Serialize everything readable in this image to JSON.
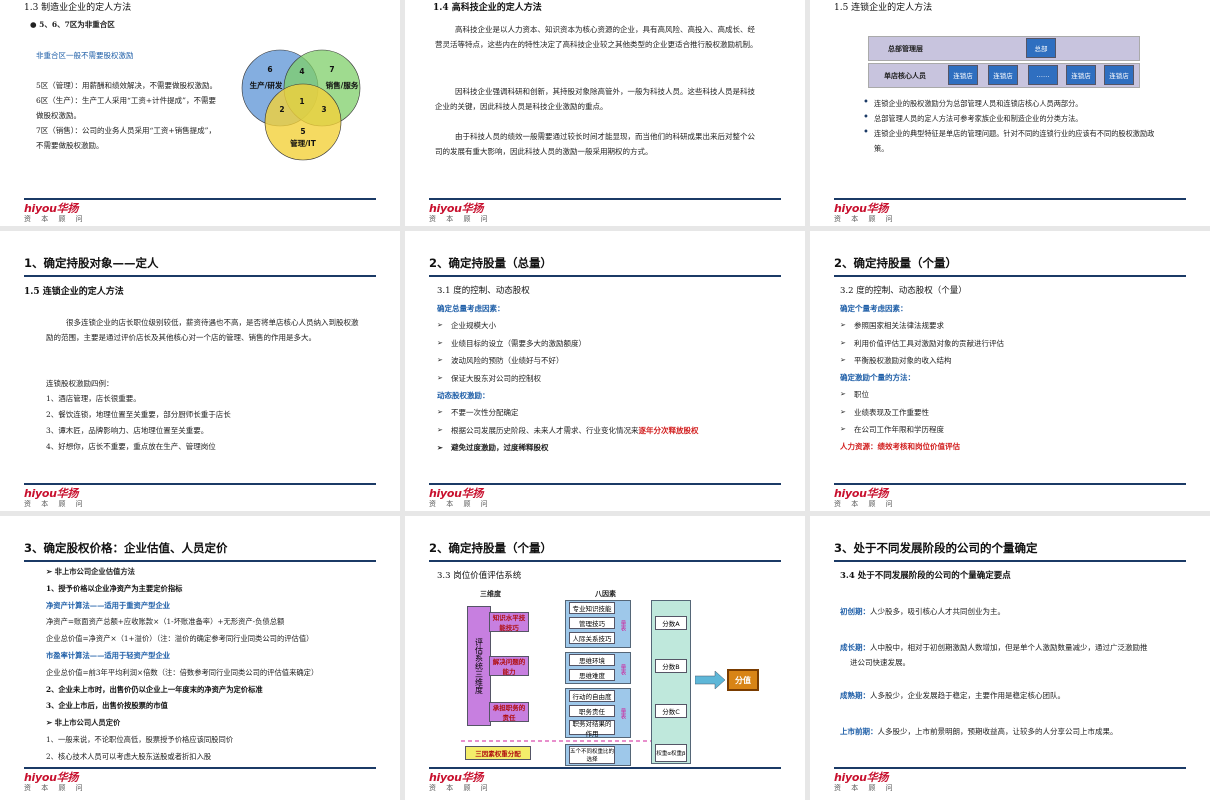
{
  "s1": {
    "section": "1.3 制造业企业的定人方法",
    "bullet": "5、6、7区为非重合区",
    "note": "非重合区一般不需要股权激励",
    "lines": [
      "5区（管理）：用薪酬和绩效解决，不需要做股权激励。",
      "6区（生产）：生产工人采用“工资+计件提成”，不需要做股权激励。",
      "7区（销售）：公司的业务人员采用“工资+销售提成”，不需要做股权激励。"
    ],
    "venn": {
      "c6": "6",
      "c7": "7",
      "c5": "5",
      "c4": "4",
      "c2": "2",
      "c3": "3",
      "c1": "1",
      "l6": "生产/研发",
      "l7": "销售/服务",
      "l5": "管理/IT"
    }
  },
  "s2": {
    "section": "1.4 高科技企业的定人方法",
    "paras": [
      "高科技企业是以人力资本、知识资本为核心资源的企业，具有高风险、高投入、高成长、经营灵活等特点，这些内在的特性决定了高科技企业较之其他类型的企业更适合推行股权激励机制。",
      "因科技企业强调科研和创新，其持股对象除高管外，一般为科技人员。这些科技人员是科技企业的关键，因此科技人员是科技企业激励的重点。",
      "由于科技人员的绩效一般需要通过较长时间才能显现，而当他们的科研成果出来后对整个公司的发展有重大影响，因此科技人员的激励一般采用期权的方式。"
    ]
  },
  "s3": {
    "section": "1.5 连锁企业的定人方法",
    "org": {
      "row1": "总部管理层",
      "row2": "单店核心人员",
      "hq": "总部",
      "store": "连锁店",
      "dots": "……"
    },
    "bullets": [
      "连锁企业的股权激励分为总部管理人员和连锁店核心人员两部分。",
      "总部管理人员的定人方法可参考家族企业和制造企业的分类方法。",
      "连锁企业的典型特征是单店的管理问题。针对不同的连锁行业的应该有不同的股权激励政策。"
    ]
  },
  "s4": {
    "title": "1、确定持股对象——定人",
    "section": "1.5 连锁企业的定人方法",
    "para": "很多连锁企业的店长职位级别较低，薪资待遇也不高，是否将单店核心人员纳入到股权激励的范围，主要是通过评价店长及其他核心对一个店的管理、销售的作用是多大。",
    "lead": "连锁股权激励四例：",
    "items": [
      "1、酒店管理，店长很重要。",
      "2、餐饮连锁，地理位置至关重要，部分厨师长重于店长",
      "3、谭木匠，品牌影响力、店地理位置至关重要。",
      "4、好想你，店长不重要，重点放在生产、管理岗位"
    ]
  },
  "s5": {
    "title": "2、确定持股量（总量）",
    "section": "3.1 度的控制、动态股权",
    "h1": "确定总量考虑因素：",
    "l1": [
      "企业规模大小",
      "业绩目标的设立（需要多大的激励额度）",
      "波动风险的预防（业绩好与不好）",
      "保证大股东对公司的控制权"
    ],
    "h2": "动态股权激励：",
    "l2a": "不要一次性分配确定",
    "l2b_pre": "根据公司发展历史阶段、未来人才需求、行业变化情况来",
    "l2b_red": "逐年分次释放股权",
    "l2c": "避免过度激励，过度稀释股权"
  },
  "s6": {
    "title": "2、确定持股量（个量）",
    "section": "3.2 度的控制、动态股权（个量）",
    "h1": "确定个量考虑因素：",
    "l1": [
      "参照国家相关法律法规要求",
      "利用价值评估工具对激励对象的贡献进行评估",
      "平衡股权激励对象的收入结构"
    ],
    "h2": "确定激励个量的方法：",
    "l2": [
      "职位",
      "业绩表现及工作重要性",
      "在公司工作年限和学历程度"
    ],
    "h3": "人力资源：绩效考核和岗位价值评估"
  },
  "s7": {
    "title": "3、确定股权价格：企业估值、人员定价",
    "lines": [
      {
        "t": "非上市公司企业估值方法",
        "k": "arrow"
      },
      {
        "t": "1、授予价格以企业净资产为主要定价指标",
        "k": "bold"
      },
      {
        "t": "净资产计算法——适用于重资产型企业",
        "k": "blue"
      },
      {
        "t": "净资产=账面资产总额+应收账款×（1-坏账准备率）+无形资产-负债总额",
        "k": "n"
      },
      {
        "t": "企业总价值=净资产×（1+溢价）（注：溢价的确定参考同行业同类公司的评估值）",
        "k": "n"
      },
      {
        "t": "市盈率计算法——适用于轻资产型企业",
        "k": "blue"
      },
      {
        "t": "企业总价值=前3年平均利润×倍数（注：倍数参考同行业同类公司的评估值来确定）",
        "k": "n"
      },
      {
        "t": "2、企业未上市时，出售价仍以企业上一年度末的净资产为定价标准",
        "k": "bold"
      },
      {
        "t": "3、企业上市后，出售价按股票的市值",
        "k": "bold"
      },
      {
        "t": "非上市公司人员定价",
        "k": "arrow"
      },
      {
        "t": "1、一般来说，不论职位高低，股票授予价格应该同股同价",
        "k": "n"
      },
      {
        "t": "2、核心技术人员可以考虑大股东送股或者折扣入股",
        "k": "n"
      }
    ]
  },
  "s8": {
    "title": "2、确定持股量（个量）",
    "section": "3.3 岗位价值评估系统",
    "col1": "三维度",
    "col2": "八因素",
    "vert": "评估系统三维度",
    "d1": "知识水平技能技巧",
    "d2": "解决问题的能力",
    "d3": "承担职务的责任",
    "f": [
      "专业知识技能",
      "管理技巧",
      "人际关系技巧",
      "思维环境",
      "思维难度",
      "行动的自由度",
      "职务责任",
      "职务对结果的作用"
    ],
    "q": "量表",
    "p": [
      "分数A",
      "分数B",
      "分数C"
    ],
    "w": "三因素权重分配",
    "wf": "五个不同权重比的选择",
    "wb": "权重α权重β",
    "res": "分值"
  },
  "s9": {
    "title": "3、处于不同发展阶段的公司的个量确定",
    "section": "3.4 处于不同发展阶段的公司的个量确定要点",
    "stages": [
      {
        "k": "初创期：",
        "v": "人少股多，吸引核心人才共同创业为主。"
      },
      {
        "k": "成长期：",
        "v": "人中股中，相对于初创期激励人数增加，但是单个人激励数量减少，通过广泛激励推进公司快速发展。"
      },
      {
        "k": "成熟期：",
        "v": "人多股少，企业发展趋于稳定，主要作用是稳定核心团队。"
      },
      {
        "k": "上市前期：",
        "v": "人多股少，上市前景明朗，预期收益高，让较多的人分享公司上市成果。"
      }
    ]
  },
  "logo": {
    "brand": "hiyou华扬",
    "sub": "资 本 顾 问"
  },
  "colors": {
    "navy": "#1b3a66",
    "red": "#c8102e",
    "blue": "#1f5fa8"
  }
}
